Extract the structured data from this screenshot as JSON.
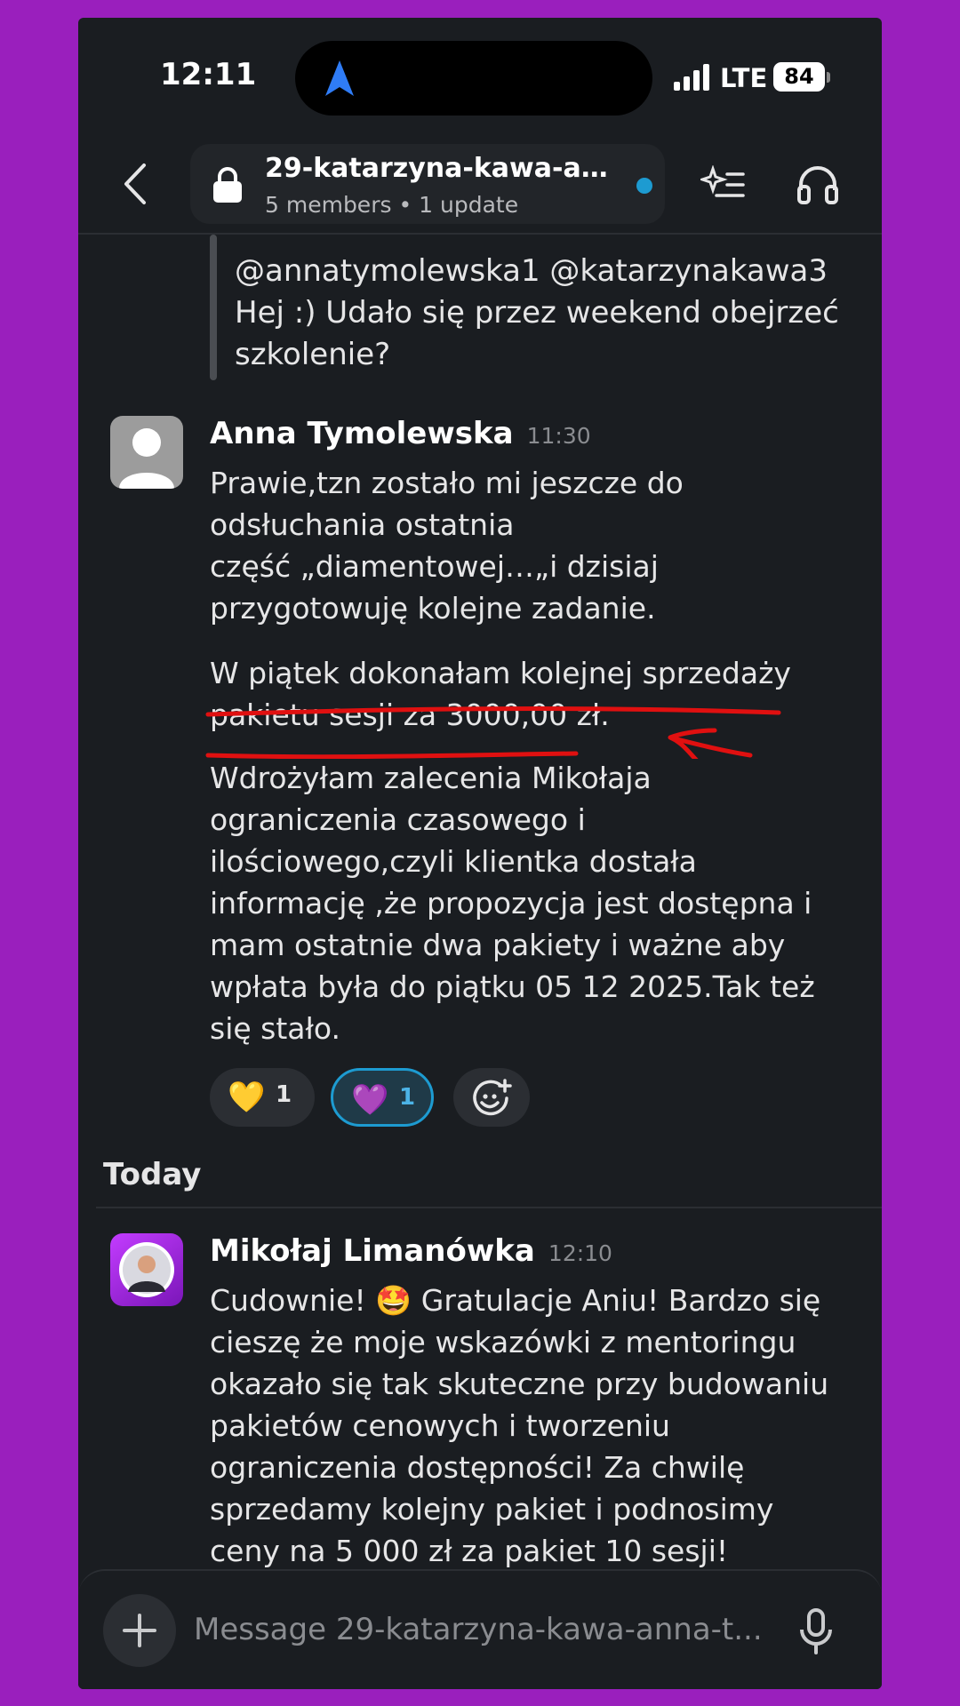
{
  "status_bar": {
    "time": "12:11",
    "network": "LTE",
    "battery": "84"
  },
  "header": {
    "channel_name": "29-katarzyna-kawa-ann...",
    "subtitle": "5 members • 1 update",
    "icons": [
      "back-icon",
      "lock-icon",
      "sparkle-list-icon",
      "headphones-icon"
    ]
  },
  "quoted_message": {
    "line1": "@annatymolewska1 @katarzynakawa3",
    "line2": "Hej :) Udało się przez weekend obejrzeć",
    "line3": "szkolenie?"
  },
  "messages": [
    {
      "author": "Anna Tymolewska",
      "time": "11:30",
      "paragraphs": [
        [
          "Prawie,tzn zostało mi jeszcze do",
          "odsłuchania ostatnia",
          "część „diamentowej…„i dzisiaj",
          "przygotowuję  kolejne zadanie."
        ],
        [
          "W piątek dokonałam kolejnej sprzedaży",
          "pakietu sesji za 3000,00 zł."
        ],
        [
          "Wdrożyłam zalecenia Mikołaja",
          "ograniczenia czasowego i",
          "ilościowego,czyli klientka dostała",
          "informację ,że propozycja jest dostępna i",
          "mam ostatnie dwa pakiety i ważne aby",
          "wpłata była do piątku 05 12 2025.Tak też",
          "się stało."
        ]
      ],
      "reactions": [
        {
          "emoji": "💛",
          "count": "1"
        },
        {
          "emoji": "💜",
          "count": "1"
        }
      ]
    },
    {
      "author": "Mikołaj Limanówka",
      "time": "12:10",
      "lines": [
        "Cudownie! 🤩 Gratulacje Aniu! Bardzo się",
        "cieszę że moje wskazówki z mentoringu",
        "okazało się tak skuteczne przy budowaniu",
        "pakietów cenowych i tworzeniu",
        "ograniczenia dostępności! Za chwilę",
        "sprzedamy kolejny pakiet i podnosimy",
        "ceny na 5 000 zł za pakiet 10 sesji!"
      ]
    }
  ],
  "day_separator": "Today",
  "composer": {
    "placeholder": "Message 29-katarzyna-kawa-anna-t..."
  },
  "colors": {
    "background": "#9a1fbd",
    "app_bg": "#1a1d21",
    "accent": "#1d9bd1",
    "annotation": "#e01010"
  }
}
